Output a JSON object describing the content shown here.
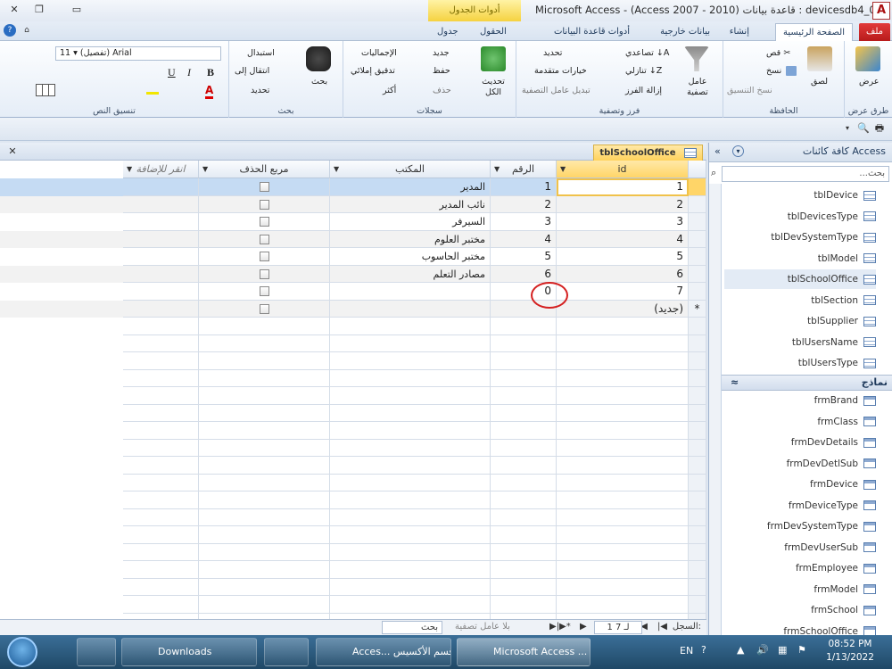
{
  "window": {
    "title": "Microsoft Access - (Access 2007 - 2010) قاعدة بيانات : devicesdb4_0",
    "context_tab": "أدوات الجدول",
    "logo": "A"
  },
  "tabs": [
    "ملف",
    "الصفحة الرئيسية",
    "إنشاء",
    "بيانات خارجية",
    "أدوات قاعدة البيانات",
    "الحقول",
    "جدول"
  ],
  "ribbon": {
    "views": {
      "label": "عرض",
      "group": "طرق عرض"
    },
    "clipboard": {
      "paste": "لصق",
      "cut": "قص",
      "copy": "نسخ",
      "format_painter": "نسخ التنسيق",
      "group": "الحافظة"
    },
    "sort_filter": {
      "filter": "عامل تصفية",
      "ascending": "تصاعدي",
      "descending": "تنازلي",
      "remove_sort": "إزالة الفرز",
      "selection": "تحديد",
      "advanced": "خيارات متقدمة",
      "toggle_filter": "تبديل عامل التصفية",
      "group": "فرز وتصفية"
    },
    "records": {
      "refresh": "تحديث الكل",
      "new": "جديد",
      "save": "حفظ",
      "delete": "حذف",
      "totals": "الإجماليات",
      "spelling": "تدقيق إملائي",
      "more": "أكثر",
      "group": "سجلات"
    },
    "find": {
      "find": "بحث",
      "replace": "استبدال",
      "goto": "انتقال إلى",
      "select": "تحديد",
      "group": "بحث"
    },
    "text_format": {
      "font": "(تفصيل) Arial",
      "size": "11",
      "bold": "B",
      "italic": "I",
      "underline": "U",
      "group": "تنسيق النص"
    }
  },
  "nav_pane": {
    "title": "كافة كائنات Access",
    "search_placeholder": "بحث...",
    "tables": [
      "tblDevice",
      "tblDevicesType",
      "tblDevSystemType",
      "tblModel",
      "tblSchoolOffice",
      "tblSection",
      "tblSupplier",
      "tblUsersName",
      "tblUsersType"
    ],
    "selected_table": "tblSchoolOffice",
    "forms_group": "نماذج",
    "forms": [
      "frmBrand",
      "frmClass",
      "frmDevDetails",
      "frmDevDetlSub",
      "frmDevice",
      "frmDeviceType",
      "frmDevSystemType",
      "frmDevUserSub",
      "frmEmployee",
      "frmModel",
      "frmSchool",
      "frmSchoolOffice"
    ]
  },
  "document": {
    "tab": "tblSchoolOffice",
    "columns": [
      "id",
      "الرقم",
      "المكتب",
      "مربع الحذف",
      "انقر للإضافة"
    ],
    "rows": [
      {
        "id": "1",
        "num": "1",
        "office": "المدير"
      },
      {
        "id": "2",
        "num": "2",
        "office": "نائب المدير"
      },
      {
        "id": "3",
        "num": "3",
        "office": "السيرفر"
      },
      {
        "id": "4",
        "num": "4",
        "office": "مختبر العلوم"
      },
      {
        "id": "5",
        "num": "5",
        "office": "مختبر الحاسوب"
      },
      {
        "id": "6",
        "num": "6",
        "office": "مصادر التعلم"
      },
      {
        "id": "7",
        "num": "0",
        "office": ""
      }
    ],
    "new_row": "(جديد)",
    "new_marker": "*"
  },
  "record_nav": {
    "label": "السجل:",
    "position": "1 لـ 7",
    "filter": "بلا عامل تصفية",
    "search": "بحث"
  },
  "taskbar": {
    "items": [
      "Downloads",
      "Acces... قسم الأكسيس",
      "Microsoft Access ..."
    ],
    "lang": "EN",
    "time": "08:52 PM",
    "date": "1/13/2022"
  }
}
